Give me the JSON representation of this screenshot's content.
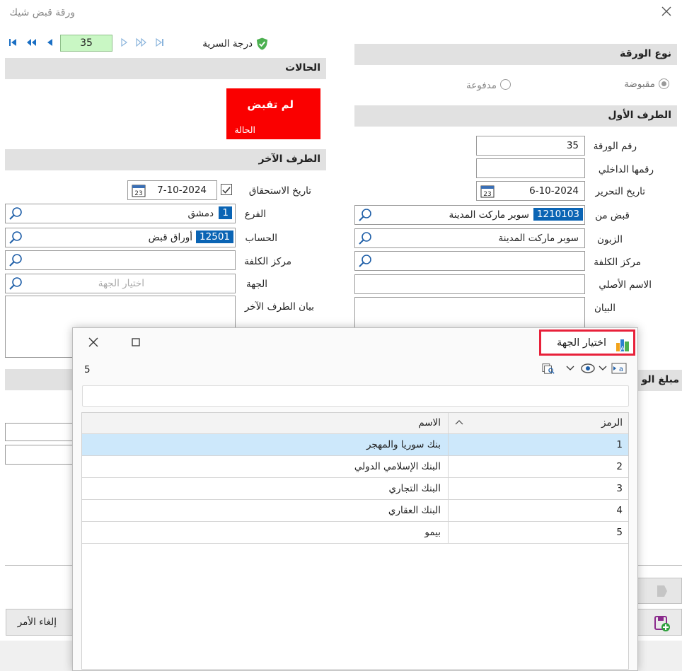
{
  "window": {
    "title": "ورقة قبض شيك"
  },
  "navigator": {
    "record": "35"
  },
  "security": {
    "label": "درجة السرية"
  },
  "sections": {
    "paper_type": "نوع الورقة",
    "statuses": "الحالات",
    "first_party": "الطرف الأول",
    "other_party": "الطرف الآخر",
    "amount_partial": "مبلغ الو"
  },
  "paper_type": {
    "option_received": "مقبوضة",
    "option_paid": "مدفوعة"
  },
  "status": {
    "value": "لم تقبض",
    "caption": "الحالة"
  },
  "first_party": {
    "paper_no_label": "رقم الورقة",
    "paper_no": "35",
    "internal_no_label": "رقمها الداخلي",
    "internal_no": "",
    "date_label": "تاريخ التحرير",
    "date": "6-10-2024",
    "received_from_label": "قبض من",
    "received_from_code": "1210103",
    "received_from_name": "سوبر ماركت المدينة",
    "customer_label": "الزبون",
    "customer": "سوبر ماركت المدينة",
    "cost_center_label": "مركز الكلفة",
    "cost_center": "",
    "original_name_label": "الاسم الأصلي",
    "original_name": "",
    "statement_label": "البيان"
  },
  "other_party": {
    "due_date_label": "تاريخ الاستحقاق",
    "due_date": "7-10-2024",
    "branch_label": "الفرع",
    "branch_code": "1",
    "branch_name": "دمشق",
    "account_label": "الحساب",
    "account_code": "12501",
    "account_name": "أوراق قبض",
    "cost_center_label": "مركز الكلفة",
    "cost_center": "",
    "entity_label": "الجهة",
    "entity_placeholder": "اختيار الجهة",
    "statement_label": "بيان الطرف الآخر"
  },
  "buttons": {
    "cancel": "إلغاء الأمر"
  },
  "dialog": {
    "title": "اختيار الجهة",
    "count": "5",
    "columns": {
      "code": "الرمز",
      "name": "الاسم"
    },
    "rows": [
      {
        "code": "1",
        "name": "بنك سوريا والمهجر"
      },
      {
        "code": "2",
        "name": "البنك الإسلامي الدولي"
      },
      {
        "code": "3",
        "name": "البنك التجاري"
      },
      {
        "code": "4",
        "name": "البنك العقاري"
      },
      {
        "code": "5",
        "name": "بيمو"
      }
    ]
  },
  "colors": {
    "status_red": "#fa0000",
    "code_badge": "#0a64b4",
    "selected_row": "#cde8fb",
    "nav_input": "#c9f7c4",
    "highlight_border": "#e8213a"
  }
}
